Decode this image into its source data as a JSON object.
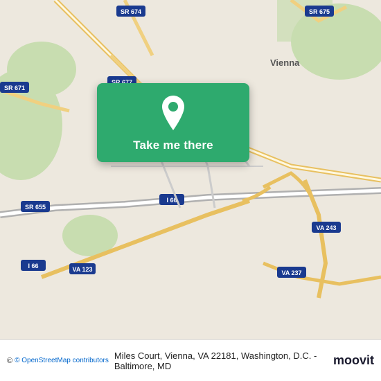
{
  "map": {
    "background_color": "#e8e0d8"
  },
  "action_card": {
    "label": "Take me there",
    "pin_icon": "location-pin-icon"
  },
  "bottom_bar": {
    "copyright": "© OpenStreetMap contributors",
    "address": "Miles Court, Vienna, VA 22181, Washington, D.C. - Baltimore, MD",
    "logo": "moovit"
  }
}
